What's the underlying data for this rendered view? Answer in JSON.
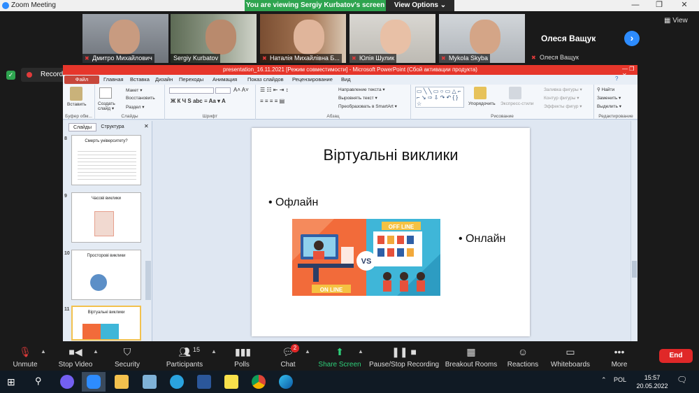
{
  "window": {
    "title": "Zoom Meeting"
  },
  "banner": {
    "viewing": "You are viewing Sergiy Kurbatov's screen",
    "view_options": "View Options ⌄"
  },
  "participants": [
    {
      "name": "Дмитро Михайлович"
    },
    {
      "name": "Sergiy Kurbatov"
    },
    {
      "name": "Наталія Михайлівна Б..."
    },
    {
      "name": "Юлія Шулик"
    },
    {
      "name": "Mykola Skyba"
    }
  ],
  "name_tile": {
    "big": "Олеся Ващук",
    "small": "Олеся Ващук"
  },
  "view_button": "View",
  "recording": {
    "label": "Recording"
  },
  "powerpoint": {
    "title": "presentation_16.11.2021 [Режим совместимости] - Microsoft PowerPoint (Сбой активации продукта)",
    "file_tab": "Файл",
    "tabs": [
      "Главная",
      "Вставка",
      "Дизайн",
      "Переходы",
      "Анимация",
      "Показ слайдов",
      "Рецензирование",
      "Вид"
    ],
    "ribbon": {
      "paste": "Вставить",
      "clipboard_group": "Буфер обм...",
      "layout": "Макет ▾",
      "reset": "Восстановить",
      "section": "Раздел ▾",
      "new_slide": "Создать слайд ▾",
      "slides_group": "Слайды",
      "font_group": "Шрифт",
      "text_direction": "Направление текста ▾",
      "align_text": "Выровнять текст ▾",
      "smartart": "Преобразовать в SmartArt ▾",
      "paragraph_group": "Абзац",
      "arrange": "Упорядочить",
      "quick_styles": "Экспресс-стили",
      "shape_fill": "Заливка фигуры ▾",
      "shape_outline": "Контур фигуры ▾",
      "shape_effects": "Эффекты фигур ▾",
      "drawing_group": "Рисование",
      "find": "Найти",
      "replace": "Заменить ▾",
      "select": "Выделить ▾",
      "editing_group": "Редактирование"
    },
    "panel_tabs": {
      "slides": "Слайды",
      "outline": "Структура"
    },
    "thumbnails": [
      {
        "num": "8",
        "title": "Смерть університету?"
      },
      {
        "num": "9",
        "title": "Часові виклики"
      },
      {
        "num": "10",
        "title": "Просторові виклики"
      },
      {
        "num": "11",
        "title": "Віртуальні виклики"
      }
    ],
    "slide": {
      "title": "Віртуальні  виклики",
      "bullet_left": "Офлайн",
      "bullet_right": "Онлайн",
      "image_text": {
        "offline": "OFF LINE",
        "online": "ON LINE",
        "vs": "VS"
      }
    }
  },
  "toolbar": {
    "unmute": "Unmute",
    "stop_video": "Stop Video",
    "security": "Security",
    "participants": "Participants",
    "participants_count": "15",
    "polls": "Polls",
    "chat": "Chat",
    "chat_badge": "2",
    "share_screen": "Share Screen",
    "recording": "Pause/Stop Recording",
    "breakout": "Breakout Rooms",
    "reactions": "Reactions",
    "whiteboards": "Whiteboards",
    "more": "More",
    "end": "End"
  },
  "taskbar": {
    "lang": "POL",
    "time": "15:57",
    "date": "20.05.2022"
  },
  "colors": {
    "zoom_blue": "#2d8cff",
    "green_banner": "#2ea44f",
    "ppt_title_red": "#e6362b",
    "end_red": "#e02828"
  }
}
